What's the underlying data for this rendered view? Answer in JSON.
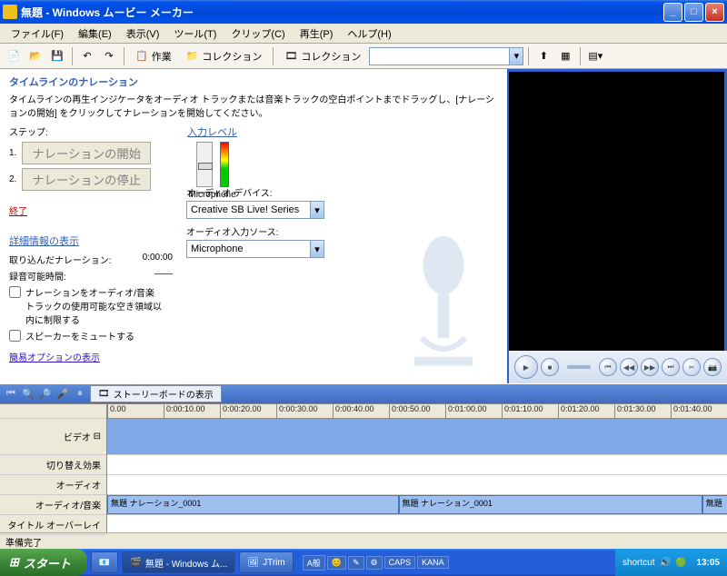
{
  "window": {
    "title": "無題 - Windows ムービー メーカー"
  },
  "menu": {
    "file": "ファイル(F)",
    "edit": "編集(E)",
    "view": "表示(V)",
    "tool": "ツール(T)",
    "clip": "クリップ(C)",
    "play": "再生(P)",
    "help": "ヘルプ(H)"
  },
  "toolbar": {
    "tasks": "作業",
    "collections": "コレクション",
    "collection_combo": "コレクション"
  },
  "narration": {
    "header": "タイムラインのナレーション",
    "instruction": "タイムラインの再生インジケータをオーディオ トラックまたは音楽トラックの空白ポイントまでドラッグし、[ナレーションの開始] をクリックしてナレーションを開始してください。",
    "steps_label": "ステップ:",
    "step1_num": "1.",
    "step1_btn": "ナレーションの開始",
    "step2_num": "2.",
    "step2_btn": "ナレーションの停止",
    "done": "終了",
    "input_level": "入力レベル",
    "mic_name": "Microphone"
  },
  "details": {
    "header": "詳細情報の表示",
    "captured_label": "取り込んだナレーション:",
    "captured_val": "0:00:00",
    "available_label": "録音可能時間:",
    "available_val": "——",
    "check1": "ナレーションをオーディオ/音楽トラックの使用可能な空き領域以内に制限する",
    "check2": "スピーカーをミュートする",
    "simple_link": "簡易オプションの表示",
    "audio_device_label": "オーディオ デバイス:",
    "audio_device": "Creative SB Live! Series",
    "audio_source_label": "オーディオ入力ソース:",
    "audio_source": "Microphone"
  },
  "timeline": {
    "storyboard_btn": "ストーリーボードの表示",
    "ruler": [
      "0.00",
      "0:00:10.00",
      "0:00:20.00",
      "0:00:30.00",
      "0:00:40.00",
      "0:00:50.00",
      "0:01:00.00",
      "0:01:10.00",
      "0:01:20.00",
      "0:01:30.00",
      "0:01:40.00"
    ],
    "tracks": {
      "video": "ビデオ",
      "transition": "切り替え効果",
      "audio": "オーディオ",
      "audio_music": "オーディオ/音楽",
      "title": "タイトル オーバーレイ"
    },
    "clip1": "無題 ナレーション_0001",
    "clip2": "無題 ナレーション_0001",
    "clip3": "無題"
  },
  "status": "準備完了",
  "taskbar": {
    "start": "スタート",
    "task1": "無題 - Windows ム...",
    "task2": "JTrim",
    "ime1": "A般",
    "ime_caps": "CAPS",
    "ime_kana": "KANA",
    "shortcut": "shortcut",
    "clock": "13:05"
  }
}
